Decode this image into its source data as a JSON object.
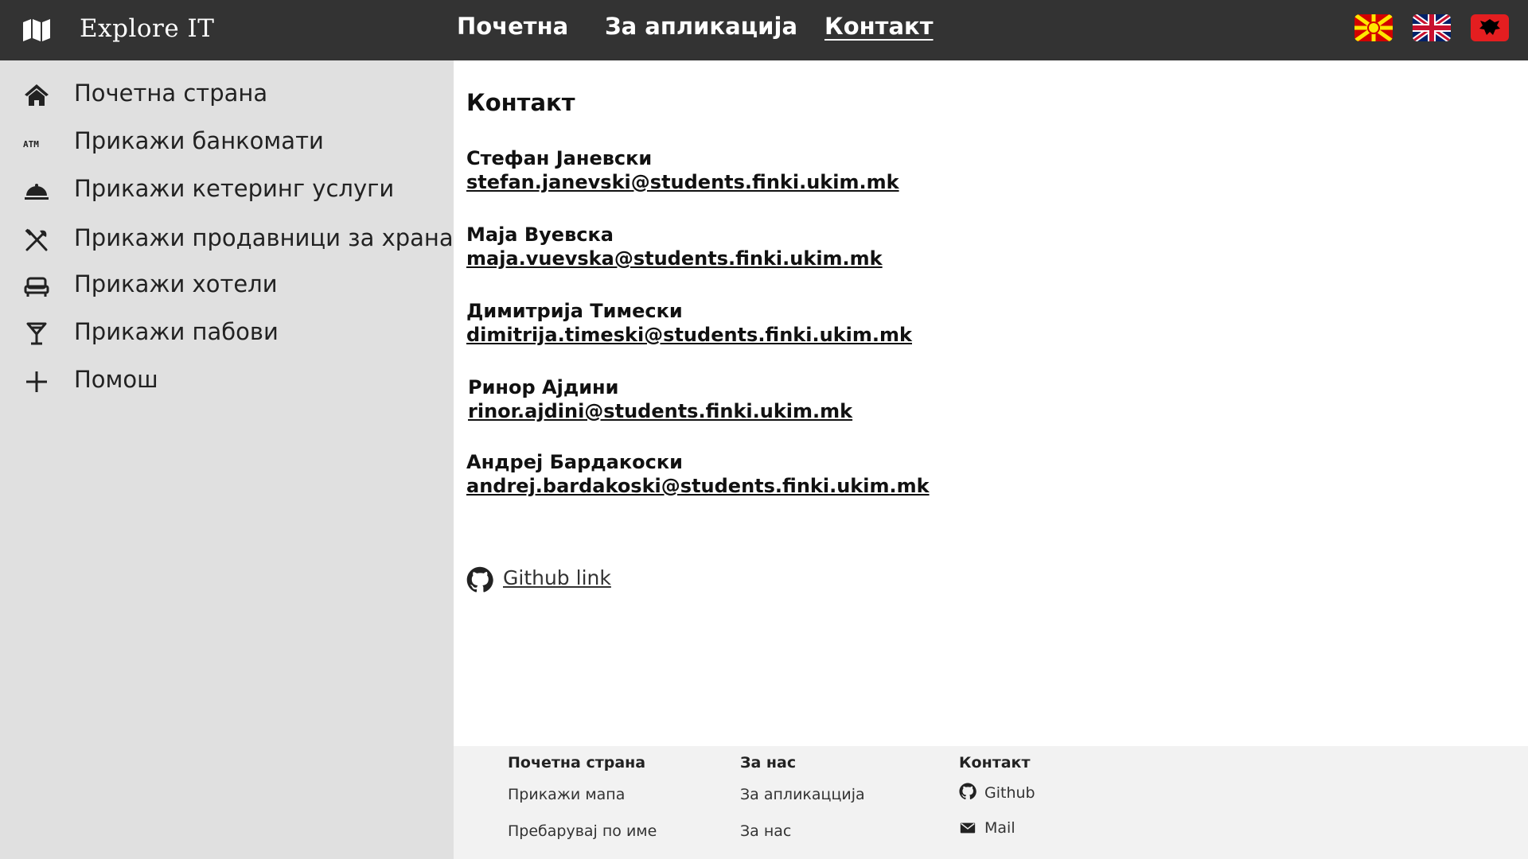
{
  "header": {
    "brand": "Explore IT",
    "nav": [
      {
        "label": "Почетна"
      },
      {
        "label": "За апликација"
      },
      {
        "label": "Контакт"
      }
    ],
    "languages": [
      "mk-flag",
      "uk-flag",
      "al-flag"
    ]
  },
  "sidebar": {
    "items": [
      {
        "label": "Почетна страна",
        "icon": "home-icon"
      },
      {
        "label": "Прикажи банкомати",
        "icon": "atm-icon"
      },
      {
        "label": "Прикажи кетеринг услуги",
        "icon": "catering-icon"
      },
      {
        "label": "Прикажи продавници за храна",
        "icon": "utensils-icon"
      },
      {
        "label": "Прикажи хотели",
        "icon": "bed-icon"
      },
      {
        "label": "Прикажи пабови",
        "icon": "cocktail-icon"
      },
      {
        "label": "Помош",
        "icon": "plus-icon"
      }
    ]
  },
  "main": {
    "title": "Контакт",
    "contacts": [
      {
        "name": "Стефан Јаневски",
        "email": "stefan.janevski@students.finki.ukim.mk"
      },
      {
        "name": "Маја Вуевска",
        "email": "maja.vuevska@students.finki.ukim.mk"
      },
      {
        "name": "Димитрија Тимески",
        "email": "dimitrija.timeski@students.finki.ukim.mk"
      },
      {
        "name": "Ринор Ајдини",
        "email": "rinor.ajdini@students.finki.ukim.mk"
      },
      {
        "name": "Андреј Бардакоски",
        "email": "andrej.bardakoski@students.finki.ukim.mk"
      }
    ],
    "github_label": "Github link"
  },
  "footer": {
    "col1": {
      "heading": "Почетна страна",
      "links": [
        "Прикажи мапа",
        "Пребарувај по име"
      ]
    },
    "col2": {
      "heading": "За нас",
      "links": [
        "За апликаццијa",
        "За нас"
      ]
    },
    "col3": {
      "heading": "Контакт",
      "links": [
        "Github",
        "Mail"
      ]
    }
  },
  "colors": {
    "topbar": "#333333",
    "sidebar": "#e0e0e0",
    "footer": "#f2f2f2"
  }
}
